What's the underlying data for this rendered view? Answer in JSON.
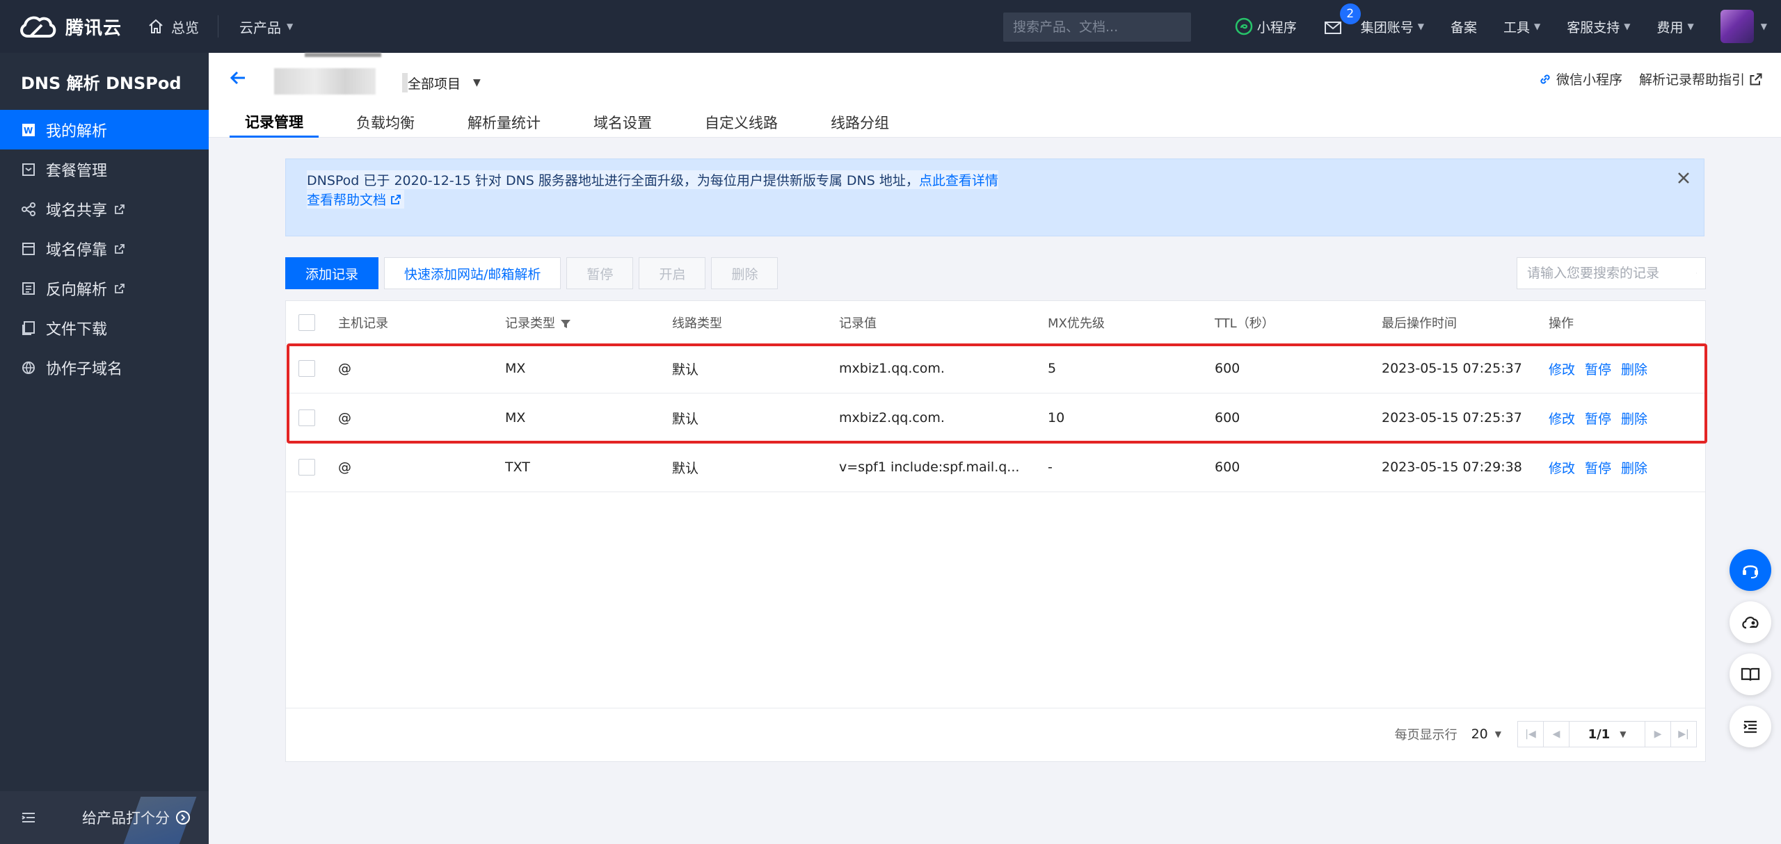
{
  "topbar": {
    "brand": "腾讯云",
    "home": "总览",
    "products": "云产品",
    "search_placeholder": "搜索产品、文档...",
    "mini_program": "小程序",
    "mail_badge": "2",
    "group_account": "集团账号",
    "filing": "备案",
    "tools": "工具",
    "support": "客服支持",
    "billing": "费用"
  },
  "sidebar": {
    "title": "DNS 解析 DNSPod",
    "items": [
      {
        "label": "我的解析",
        "icon": "domain-w-icon",
        "external": false,
        "active": true
      },
      {
        "label": "套餐管理",
        "icon": "package-icon",
        "external": false,
        "active": false
      },
      {
        "label": "域名共享",
        "icon": "share-icon",
        "external": true,
        "active": false
      },
      {
        "label": "域名停靠",
        "icon": "parking-icon",
        "external": true,
        "active": false
      },
      {
        "label": "反向解析",
        "icon": "reverse-icon",
        "external": true,
        "active": false
      },
      {
        "label": "文件下载",
        "icon": "download-icon",
        "external": false,
        "active": false
      },
      {
        "label": "协作子域名",
        "icon": "globe-icon",
        "external": false,
        "active": false
      }
    ],
    "rate_label": "给产品打个分"
  },
  "header": {
    "project": "全部项目",
    "links": [
      {
        "label": "微信小程序",
        "icon": "link-icon"
      },
      {
        "label": "解析记录帮助指引",
        "icon": "external-link-icon"
      }
    ],
    "tabs": [
      "记录管理",
      "负载均衡",
      "解析量统计",
      "域名设置",
      "自定义线路",
      "线路分组"
    ],
    "active_tab": 0
  },
  "notice": {
    "text": "DNSPod 已于 2020-12-15 针对 DNS 服务器地址进行全面升级，为每位用户提供新版专属 DNS 地址，",
    "link": "点此查看详情",
    "help": "查看帮助文档"
  },
  "toolbar": {
    "add": "添加记录",
    "quick_add": "快速添加网站/邮箱解析",
    "pause": "暂停",
    "enable": "开启",
    "delete": "删除",
    "search_placeholder": "请输入您要搜索的记录"
  },
  "table": {
    "columns": [
      "主机记录",
      "记录类型",
      "线路类型",
      "记录值",
      "MX优先级",
      "TTL（秒）",
      "最后操作时间",
      "操作"
    ],
    "rows": [
      {
        "host": "@",
        "type": "MX",
        "line": "默认",
        "value": "mxbiz1.qq.com.",
        "mx": "5",
        "ttl": "600",
        "time": "2023-05-15 07:25:37"
      },
      {
        "host": "@",
        "type": "MX",
        "line": "默认",
        "value": "mxbiz2.qq.com.",
        "mx": "10",
        "ttl": "600",
        "time": "2023-05-15 07:25:37"
      },
      {
        "host": "@",
        "type": "TXT",
        "line": "默认",
        "value": "v=spf1 include:spf.mail.q...",
        "mx": "-",
        "ttl": "600",
        "time": "2023-05-15 07:29:38"
      }
    ],
    "ops": {
      "edit": "修改",
      "pause": "暂停",
      "delete": "删除"
    },
    "highlighted_rows": [
      0,
      1
    ]
  },
  "pagination": {
    "per_page_label": "每页显示行",
    "per_page": "20",
    "current": "1/1"
  },
  "colors": {
    "accent": "#006eff",
    "topbar_bg": "#222a3a",
    "sidebar_bg": "#262f3e",
    "highlight": "#e32525"
  }
}
